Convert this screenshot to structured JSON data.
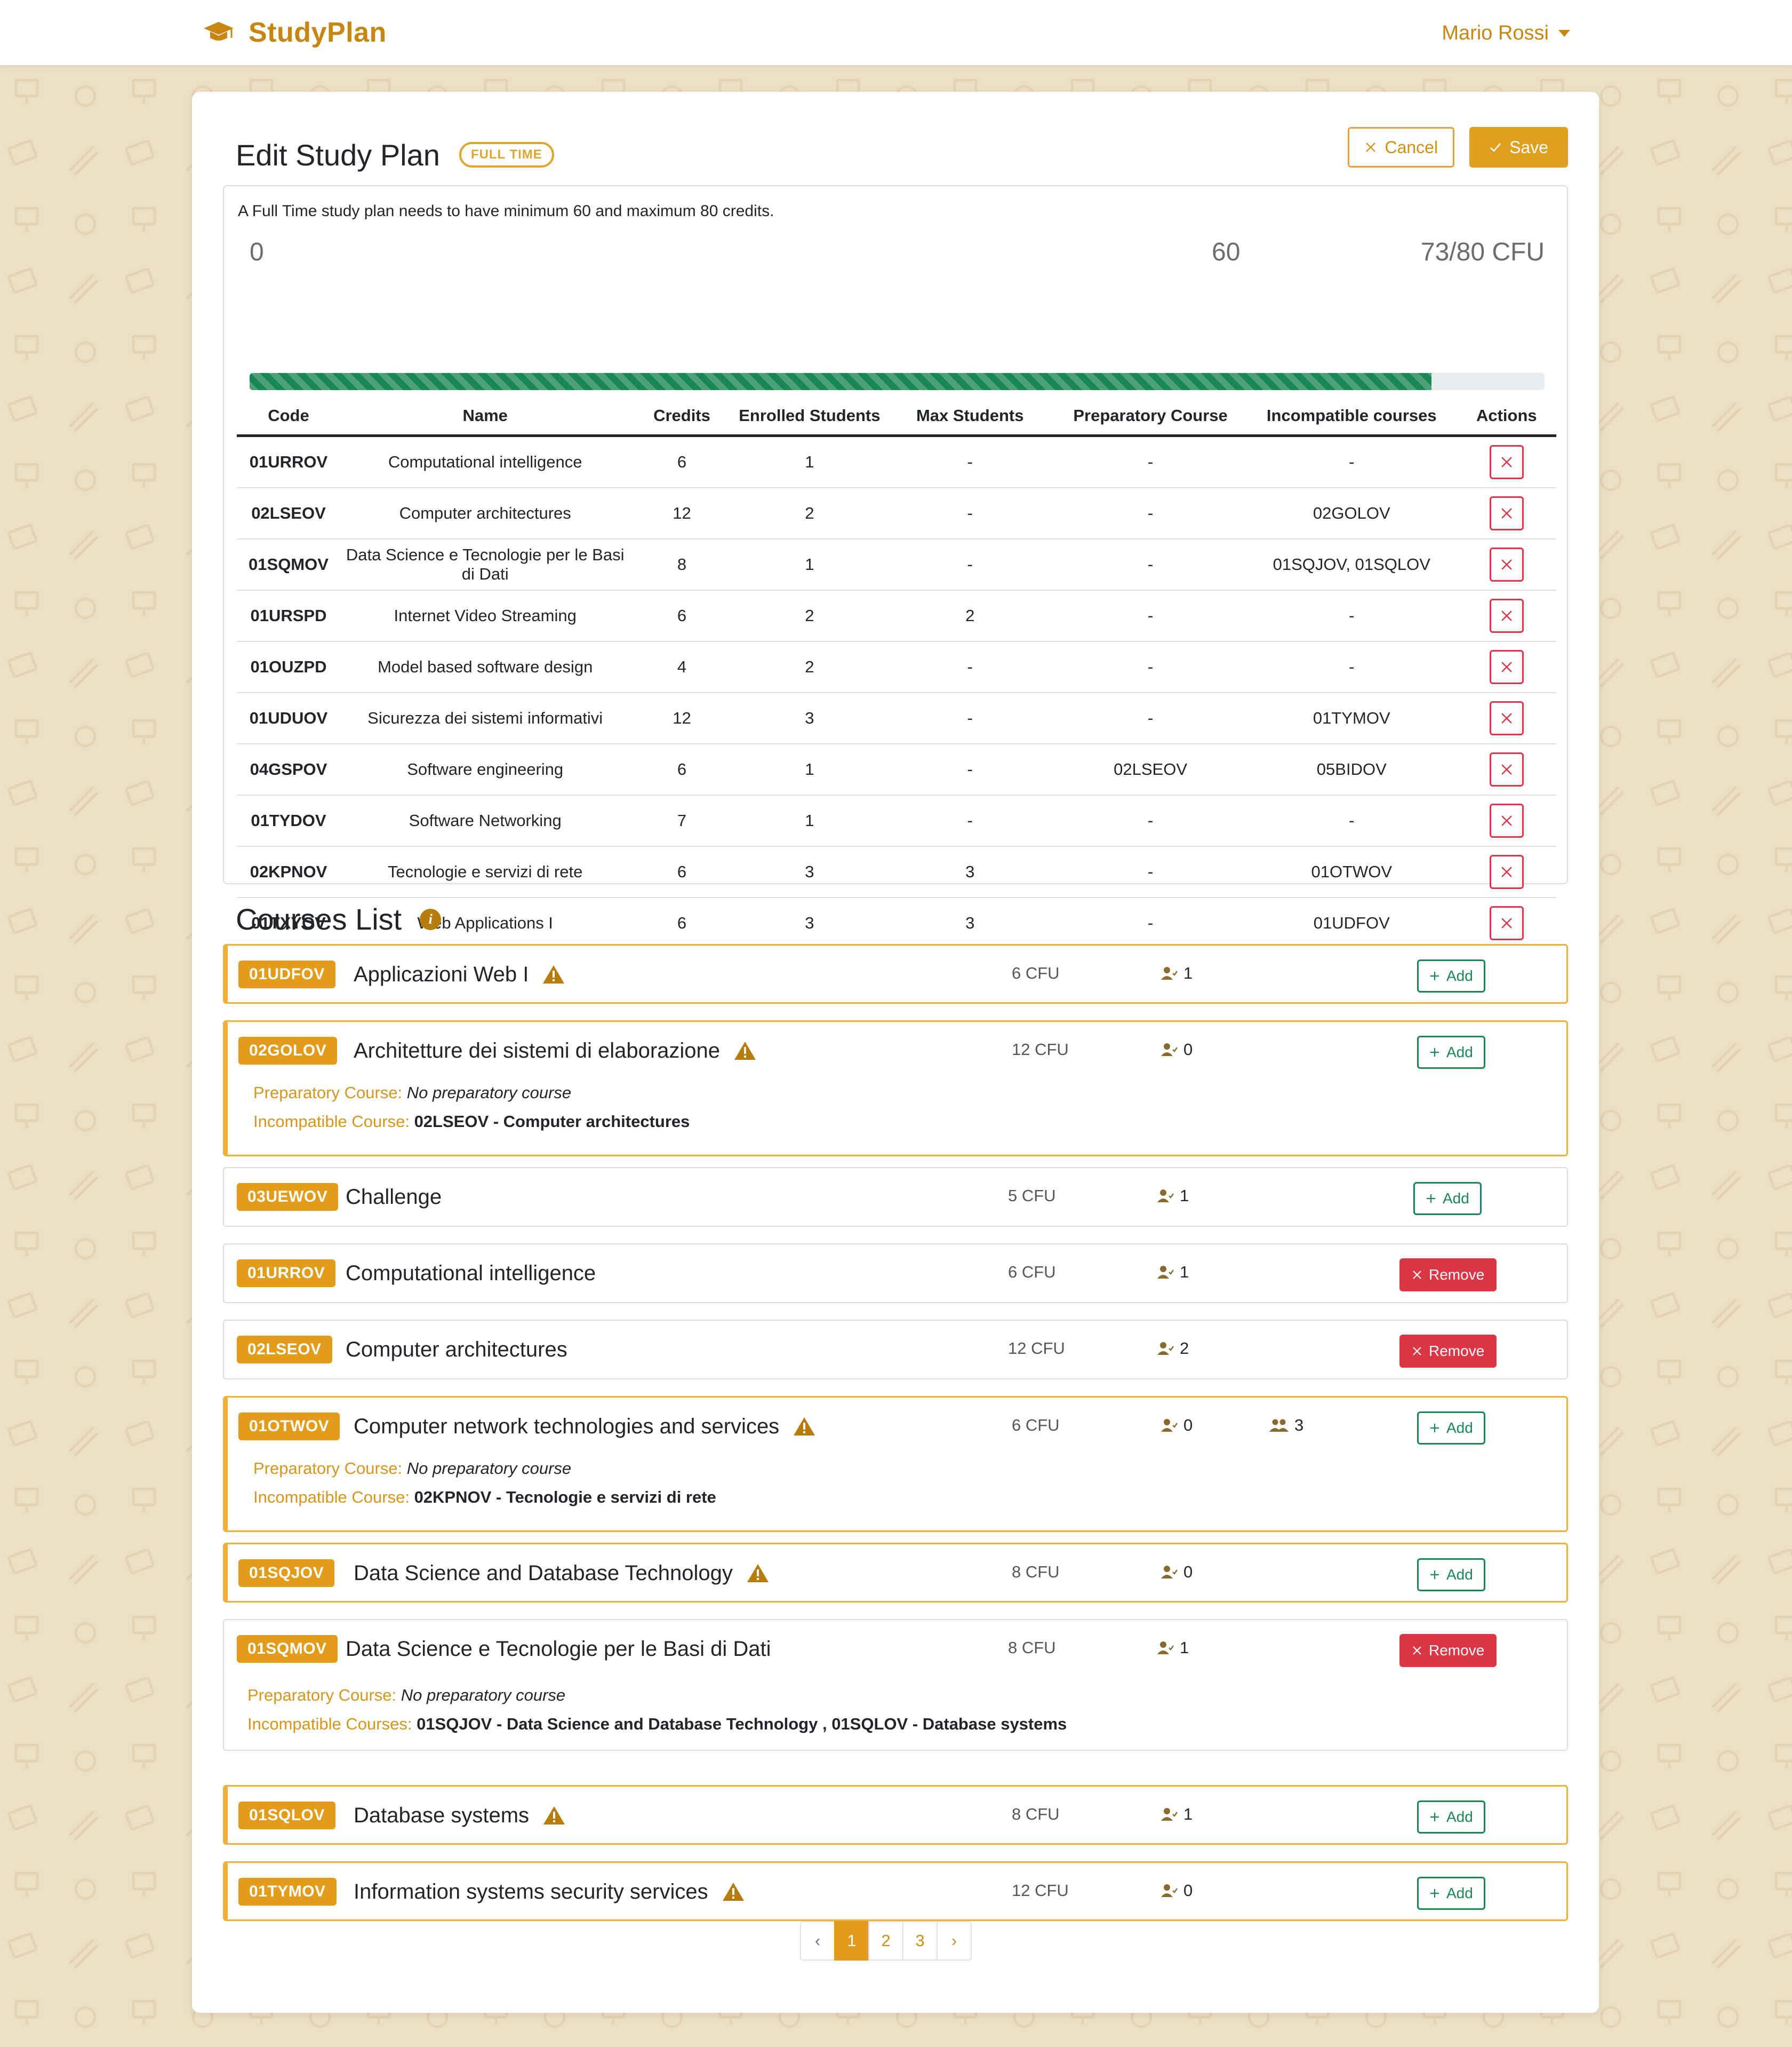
{
  "brand": {
    "name": "StudyPlan",
    "icon": "graduation-cap-icon"
  },
  "user": {
    "name": "Mario Rossi"
  },
  "header": {
    "title": "Edit Study Plan",
    "type_badge": "FULL TIME",
    "cancel_label": "Cancel",
    "save_label": "Save"
  },
  "plan": {
    "description": "A Full Time study plan needs to have minimum 60 and maximum 80 credits.",
    "progress": {
      "min_label": "0",
      "threshold_label": "60",
      "total_label": "73/80 CFU",
      "credits": 73,
      "max": 80
    },
    "columns": [
      "Code",
      "Name",
      "Credits",
      "Enrolled Students",
      "Max Students",
      "Preparatory Course",
      "Incompatible courses",
      "Actions"
    ],
    "rows": [
      {
        "code": "01URROV",
        "name": "Computational intelligence",
        "credits": "6",
        "enrolled": "1",
        "max": "-",
        "prep": "-",
        "incompat": "-"
      },
      {
        "code": "02LSEOV",
        "name": "Computer architectures",
        "credits": "12",
        "enrolled": "2",
        "max": "-",
        "prep": "-",
        "incompat": "02GOLOV"
      },
      {
        "code": "01SQMOV",
        "name": "Data Science e Tecnologie per le Basi di Dati",
        "credits": "8",
        "enrolled": "1",
        "max": "-",
        "prep": "-",
        "incompat": "01SQJOV, 01SQLOV"
      },
      {
        "code": "01URSPD",
        "name": "Internet Video Streaming",
        "credits": "6",
        "enrolled": "2",
        "max": "2",
        "prep": "-",
        "incompat": "-"
      },
      {
        "code": "01OUZPD",
        "name": "Model based software design",
        "credits": "4",
        "enrolled": "2",
        "max": "-",
        "prep": "-",
        "incompat": "-"
      },
      {
        "code": "01UDUOV",
        "name": "Sicurezza dei sistemi informativi",
        "credits": "12",
        "enrolled": "3",
        "max": "-",
        "prep": "-",
        "incompat": "01TYMOV"
      },
      {
        "code": "04GSPOV",
        "name": "Software engineering",
        "credits": "6",
        "enrolled": "1",
        "max": "-",
        "prep": "02LSEOV",
        "incompat": "05BIDOV"
      },
      {
        "code": "01TYDOV",
        "name": "Software Networking",
        "credits": "7",
        "enrolled": "1",
        "max": "-",
        "prep": "-",
        "incompat": "-"
      },
      {
        "code": "02KPNOV",
        "name": "Tecnologie e servizi di rete",
        "credits": "6",
        "enrolled": "3",
        "max": "3",
        "prep": "-",
        "incompat": "01OTWOV"
      },
      {
        "code": "01TXYOV",
        "name": "Web Applications I",
        "credits": "6",
        "enrolled": "3",
        "max": "3",
        "prep": "-",
        "incompat": "01UDFOV"
      }
    ]
  },
  "courses_list": {
    "title": "Courses List",
    "add_label": "Add",
    "remove_label": "Remove",
    "labels": {
      "preparatory": "Preparatory Course:",
      "incompatible": "Incompatible Course:",
      "incompatible_plural": "Incompatible Courses:",
      "no_prep": "No preparatory course"
    },
    "items": [
      {
        "code": "01UDFOV",
        "name": "Applicazioni Web I",
        "cfu": "6 CFU",
        "enrolled": "1",
        "warning": true,
        "action": "add"
      },
      {
        "code": "02GOLOV",
        "name": "Architetture dei sistemi di elaborazione",
        "cfu": "12 CFU",
        "enrolled": "0",
        "warning": true,
        "action": "add",
        "incompatible": "02LSEOV - Computer architectures"
      },
      {
        "code": "03UEWOV",
        "name": "Challenge",
        "cfu": "5 CFU",
        "enrolled": "1",
        "warning": false,
        "action": "add"
      },
      {
        "code": "01URROV",
        "name": "Computational intelligence",
        "cfu": "6 CFU",
        "enrolled": "1",
        "warning": false,
        "action": "remove"
      },
      {
        "code": "02LSEOV",
        "name": "Computer architectures",
        "cfu": "12 CFU",
        "enrolled": "2",
        "warning": false,
        "action": "remove"
      },
      {
        "code": "01OTWOV",
        "name": "Computer network technologies and services",
        "cfu": "6 CFU",
        "enrolled": "0",
        "max": "3",
        "warning": true,
        "action": "add",
        "incompatible": "02KPNOV - Tecnologie e servizi di rete"
      },
      {
        "code": "01SQJOV",
        "name": "Data Science and Database Technology",
        "cfu": "8 CFU",
        "enrolled": "0",
        "warning": true,
        "action": "add"
      },
      {
        "code": "01SQMOV",
        "name": "Data Science e Tecnologie per le Basi di Dati",
        "cfu": "8 CFU",
        "enrolled": "1",
        "warning": false,
        "action": "remove",
        "incompatible": "01SQJOV - Data Science and Database Technology , 01SQLOV - Database systems"
      },
      {
        "code": "01SQLOV",
        "name": "Database systems",
        "cfu": "8 CFU",
        "enrolled": "1",
        "warning": true,
        "action": "add"
      },
      {
        "code": "01TYMOV",
        "name": "Information systems security services",
        "cfu": "12 CFU",
        "enrolled": "0",
        "warning": true,
        "action": "add"
      }
    ]
  },
  "pagination": {
    "prev": "‹",
    "pages": [
      "1",
      "2",
      "3"
    ],
    "next": "›",
    "active": "1"
  },
  "colors": {
    "accent": "#e39b1a",
    "progress": "#198754",
    "danger": "#dc3545",
    "warning_border": "#efb13c",
    "background": "#ecdfc4"
  }
}
